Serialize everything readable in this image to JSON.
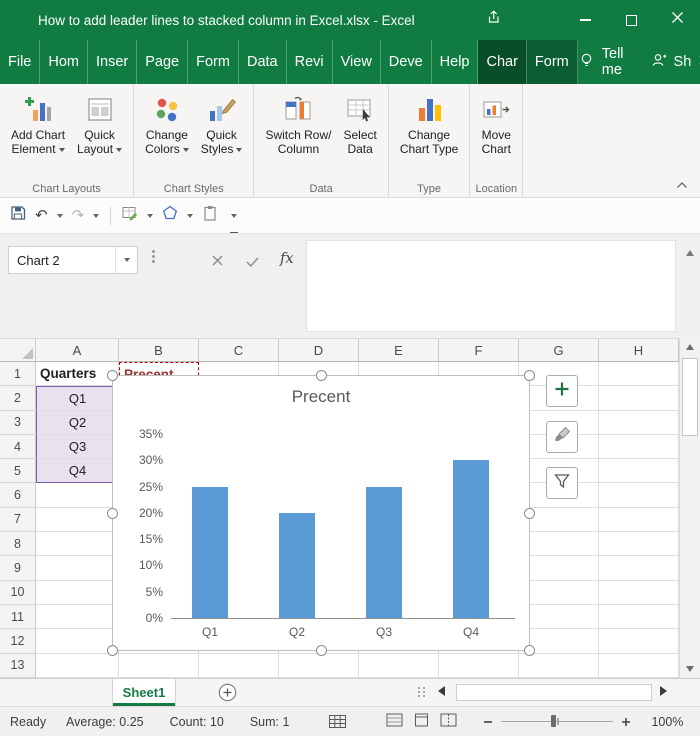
{
  "window": {
    "title": "How to add leader lines to stacked column in Excel.xlsx  -  Excel"
  },
  "menu": {
    "tabs": [
      {
        "label": "File"
      },
      {
        "label": "Hom"
      },
      {
        "label": "Inser"
      },
      {
        "label": "Page"
      },
      {
        "label": "Form"
      },
      {
        "label": "Data"
      },
      {
        "label": "Revi"
      },
      {
        "label": "View"
      },
      {
        "label": "Deve"
      },
      {
        "label": "Help"
      },
      {
        "label": "Char",
        "active": true,
        "contextual": true
      },
      {
        "label": "Form",
        "contextual": true
      }
    ],
    "tell_me": "Tell me",
    "share": "Sh"
  },
  "ribbon": {
    "buttons": [
      {
        "line1": "Add Chart",
        "line2": "Element"
      },
      {
        "line1": "Quick",
        "line2": "Layout"
      },
      {
        "line1": "Change",
        "line2": "Colors"
      },
      {
        "line1": "Quick",
        "line2": "Styles"
      },
      {
        "line1": "Switch Row/",
        "line2": "Column"
      },
      {
        "line1": "Select",
        "line2": "Data"
      },
      {
        "line1": "Change",
        "line2": "Chart Type"
      },
      {
        "line1": "Move",
        "line2": "Chart"
      }
    ],
    "groups": [
      {
        "label": "Chart Layouts"
      },
      {
        "label": "Chart Styles"
      },
      {
        "label": "Data"
      },
      {
        "label": "Type"
      },
      {
        "label": "Location"
      }
    ]
  },
  "formula_bar": {
    "name_box": "Chart 2",
    "fx": "fx"
  },
  "grid": {
    "columns": [
      "A",
      "B",
      "C",
      "D",
      "E",
      "F",
      "G",
      "H"
    ],
    "rows": [
      "1",
      "2",
      "3",
      "4",
      "5",
      "6",
      "7",
      "8",
      "9",
      "10",
      "11",
      "12",
      "13"
    ],
    "cells": {
      "A1": "Quarters",
      "B1": "Precent",
      "A2": "Q1",
      "A3": "Q2",
      "A4": "Q3",
      "A5": "Q4"
    },
    "bold_cells": [
      "A1",
      "B1"
    ],
    "red_cell": "B1",
    "selected_range": [
      "A2",
      "A3",
      "A4",
      "A5"
    ]
  },
  "chart_data": {
    "type": "bar",
    "title": "Precent",
    "categories": [
      "Q1",
      "Q2",
      "Q3",
      "Q4"
    ],
    "values": [
      25,
      20,
      25,
      30
    ],
    "value_unit": "%",
    "yticks": [
      "35%",
      "30%",
      "25%",
      "20%",
      "15%",
      "10%",
      "5%",
      "0%"
    ],
    "ylim": [
      0,
      35
    ],
    "grid": false,
    "legend": false,
    "bar_color": "#5B9BD5",
    "title_color": "#595959"
  },
  "sheet_bar": {
    "tabs": [
      {
        "label": "Sheet1",
        "active": true
      }
    ]
  },
  "status_bar": {
    "mode": "Ready",
    "average": "Average: 0.25",
    "count": "Count: 10",
    "sum": "Sum: 1",
    "zoom": "100%"
  }
}
